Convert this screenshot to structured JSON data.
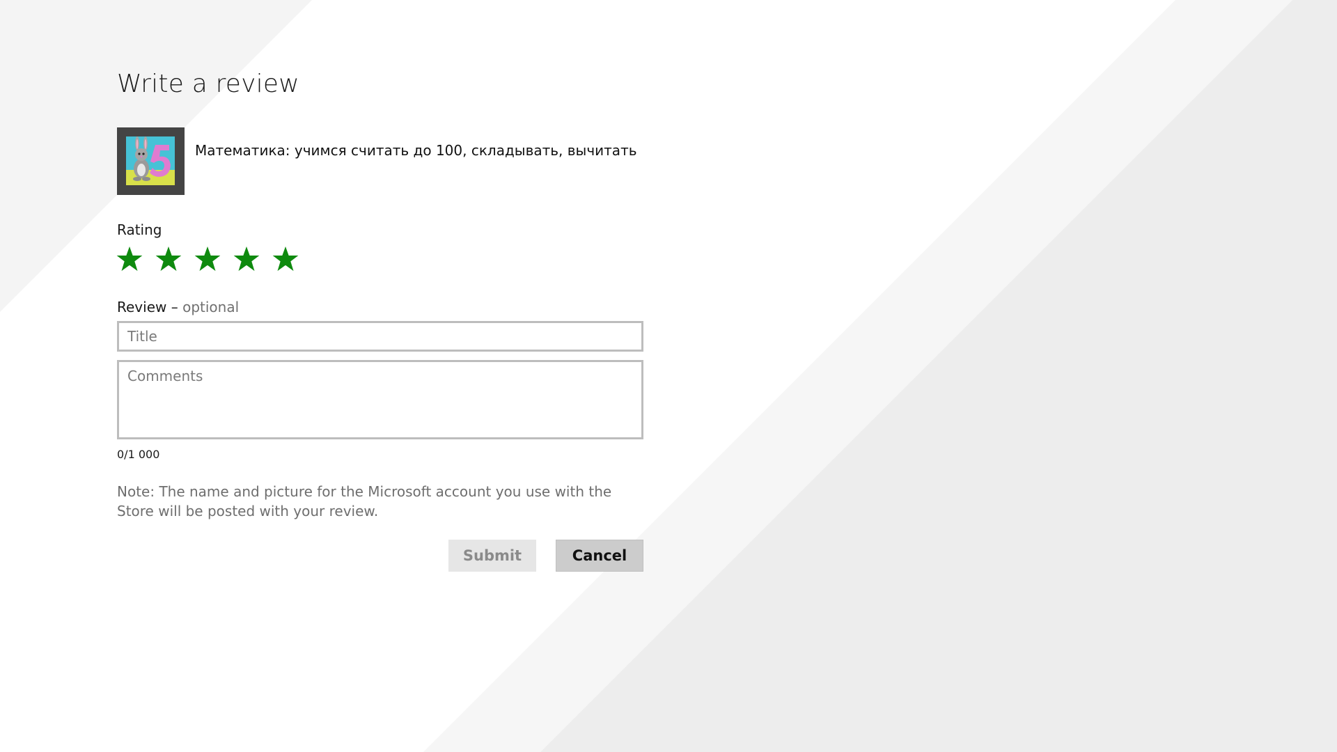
{
  "page": {
    "title": "Write a review"
  },
  "app": {
    "name": "Математика: учимся считать до 100, складывать, вычитать",
    "icon": "bunny-number-five-app-icon"
  },
  "rating": {
    "label": "Rating",
    "value": 5,
    "max": 5,
    "star_color": "#0e8a0e"
  },
  "review": {
    "label": "Review",
    "separator": " – ",
    "optional": "optional",
    "title_placeholder": "Title",
    "title_value": "",
    "comments_placeholder": "Comments",
    "comments_value": "",
    "counter": "0/1 000"
  },
  "note": "Note: The name and picture for the Microsoft account you use with the Store will be posted with your review.",
  "buttons": {
    "submit_label": "Submit",
    "submit_enabled": false,
    "cancel_label": "Cancel"
  }
}
